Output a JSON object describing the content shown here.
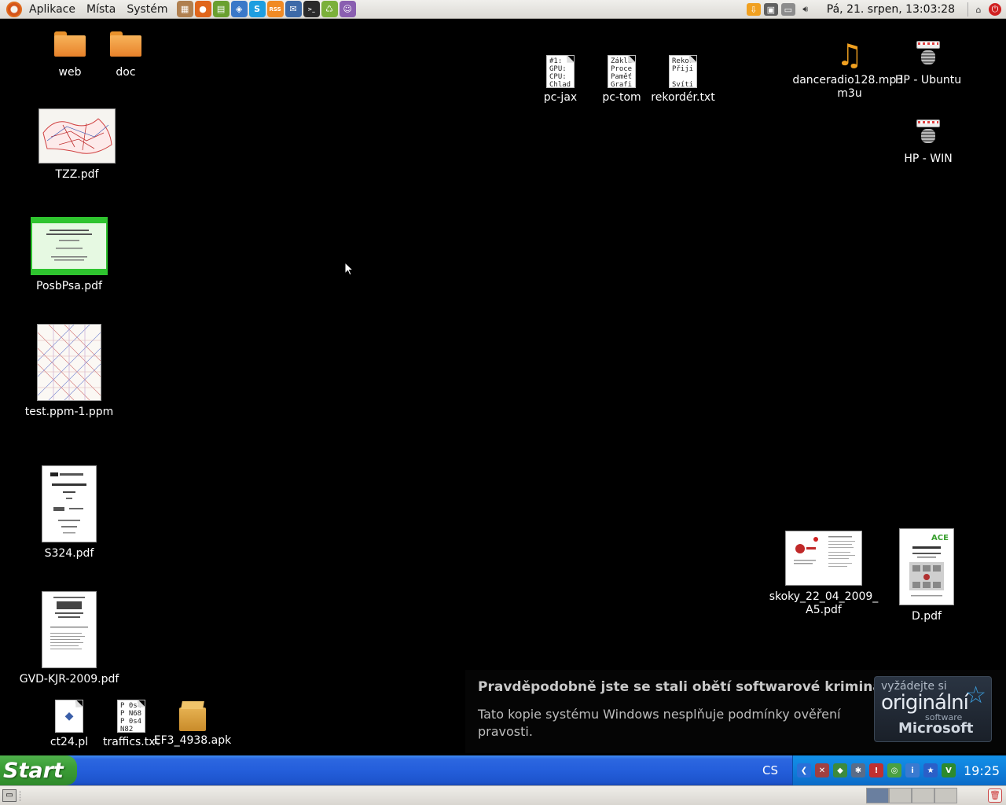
{
  "top_panel": {
    "menus": [
      "Aplikace",
      "Místa",
      "Systém"
    ],
    "launchers": [
      {
        "icon": "presentation-icon",
        "color": "#b08050",
        "glyph": "▦"
      },
      {
        "icon": "firefox-icon",
        "color": "#e0661c",
        "glyph": "●"
      },
      {
        "icon": "calculator-icon",
        "color": "#6aa030",
        "glyph": "▤"
      },
      {
        "icon": "network-icon",
        "color": "#3a78c8",
        "glyph": "◈"
      },
      {
        "icon": "skype-icon",
        "color": "#1e9ee0",
        "glyph": "S"
      },
      {
        "icon": "rss-icon",
        "color": "#f08a24",
        "glyph": "RSS"
      },
      {
        "icon": "thunderbird-icon",
        "color": "#3d6aa8",
        "glyph": "✉"
      },
      {
        "icon": "terminal-icon",
        "color": "#2b2b2b",
        "glyph": ">_"
      },
      {
        "icon": "recycle-icon",
        "color": "#7bb03a",
        "glyph": "♺"
      },
      {
        "icon": "pidgin-icon",
        "color": "#8a5fb0",
        "glyph": "☺"
      }
    ],
    "clock": "Pá, 21. srpen, 13:03:28"
  },
  "desktop_icons": [
    {
      "label": "web",
      "kind": "folder"
    },
    {
      "label": "doc",
      "kind": "folder"
    },
    {
      "label": "TZZ.pdf",
      "kind": "pdf-map"
    },
    {
      "label": "PosbPsa.pdf",
      "kind": "pdf-green"
    },
    {
      "label": "test.ppm-1.ppm",
      "kind": "image-ppm"
    },
    {
      "label": "S324.pdf",
      "kind": "pdf-doc"
    },
    {
      "label": "GVD-KJR-2009.pdf",
      "kind": "pdf-doc"
    },
    {
      "label": "ct24.pl",
      "kind": "script"
    },
    {
      "label": "traffics.txt",
      "kind": "text",
      "preview": [
        "P 0s4",
        "P N68",
        "P 0s4",
        "  N82"
      ]
    },
    {
      "label": "EF3_4938.apk",
      "kind": "package"
    },
    {
      "label": "pc-jax",
      "kind": "text",
      "preview": [
        "#1:",
        "GPU:",
        "CPU:",
        "Chlad"
      ]
    },
    {
      "label": "pc-tom",
      "kind": "text",
      "preview": [
        "Zákla",
        "Proce",
        "Paměť",
        "Grafi"
      ]
    },
    {
      "label": "rekordér.txt",
      "kind": "text",
      "preview": [
        "Rekor",
        "Přiji",
        "",
        "Svíti"
      ]
    },
    {
      "label": "danceradio128.mp3.m3u",
      "label_lines": [
        "danceradio128.mp3.",
        "m3u"
      ],
      "kind": "audio"
    },
    {
      "label": "HP - Ubuntu",
      "kind": "printer"
    },
    {
      "label": "HP - WIN",
      "kind": "printer"
    },
    {
      "label": "skoky_22_04_2009_A5.pdf",
      "label_lines": [
        "skoky_22_04_2009_",
        "A5.pdf"
      ],
      "kind": "pdf-doc"
    },
    {
      "label": "D.pdf",
      "kind": "pdf-doc"
    }
  ],
  "wga_notice": {
    "headline": "Pravděpodobně jste se stali obětí softwarové kriminality.",
    "body": "Tato kopie systému Windows nesplňuje podmínky ověření pravosti.",
    "badge_top": "vyžádejte si",
    "badge_main": "originální",
    "badge_software": "software",
    "badge_brand": "Microsoft"
  },
  "taskbar": {
    "start_label": "Start",
    "language": "CS",
    "clock": "19:25",
    "tray_icons": [
      {
        "icon": "back-arrow-icon",
        "color": "#2a6fd8",
        "glyph": "❮"
      },
      {
        "icon": "network-disconnected-icon",
        "color": "#a04040",
        "glyph": "✕"
      },
      {
        "icon": "shield-icon",
        "color": "#3d8a3d",
        "glyph": "◆"
      },
      {
        "icon": "settings-icon",
        "color": "#5a6c88",
        "glyph": "✱"
      },
      {
        "icon": "security-alert-icon",
        "color": "#c03030",
        "glyph": "!"
      },
      {
        "icon": "chrome-icon",
        "color": "#4aa040",
        "glyph": "◎"
      },
      {
        "icon": "update-icon",
        "color": "#3a7ad0",
        "glyph": "i"
      },
      {
        "icon": "star-icon",
        "color": "#2a5fc8",
        "glyph": "★"
      },
      {
        "icon": "antivirus-icon",
        "color": "#2d8a2d",
        "glyph": "V"
      }
    ]
  },
  "bottom_panel": {
    "workspaces": 4
  }
}
